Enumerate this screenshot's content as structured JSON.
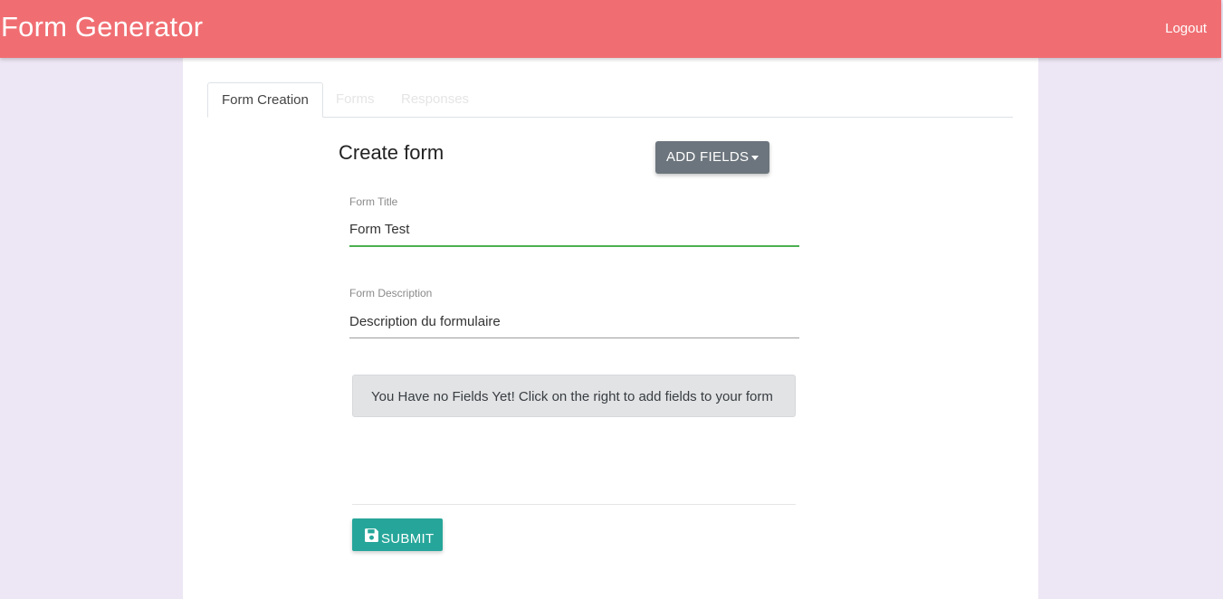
{
  "navbar": {
    "brand": "Form Generator",
    "logout_label": "Logout"
  },
  "tabs": [
    {
      "label": "Form Creation",
      "active": true
    },
    {
      "label": "Forms",
      "active": false
    },
    {
      "label": "Responses",
      "active": false
    }
  ],
  "form": {
    "heading": "Create form",
    "add_fields_label": "ADD FIELDS",
    "title_label": "Form Title",
    "title_value": "Form Test",
    "description_label": "Form Description",
    "description_value": "Description du formulaire",
    "empty_message": "You Have no Fields Yet! Click on the right to add fields to your form",
    "submit_label": "SUBMIT",
    "submit_icon": "save-icon"
  },
  "colors": {
    "navbar": "#f06e72",
    "background": "#ede6f4",
    "add_fields_button": "#6c757d",
    "submit_button": "#26a69a",
    "active_underline": "#4caf50"
  }
}
